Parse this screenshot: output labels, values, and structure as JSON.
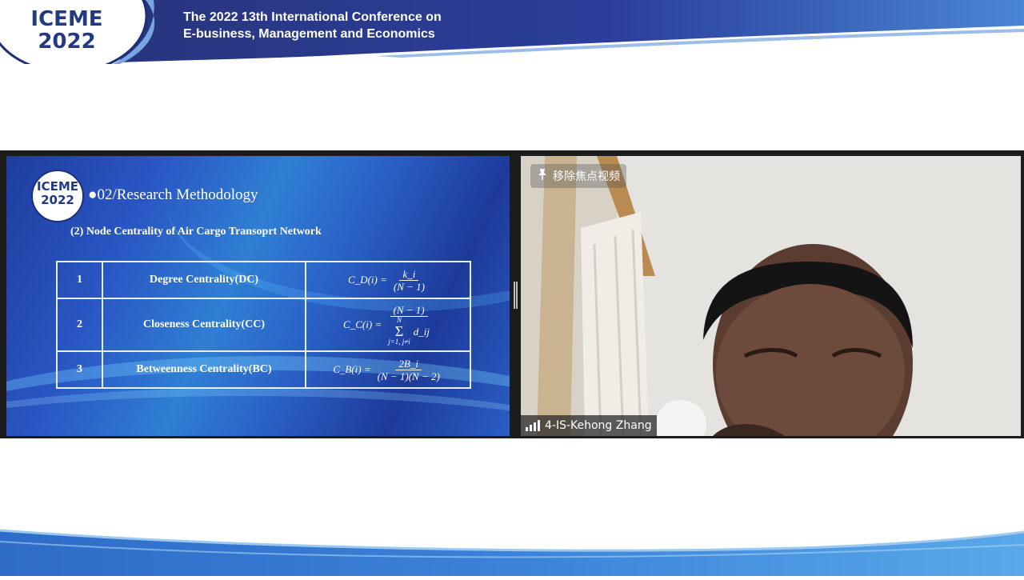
{
  "banner": {
    "logo_line1": "ICEME",
    "logo_line2": "2022",
    "title_line1": "The 2022 13th International Conference on",
    "title_line2": "E-business, Management and Economics"
  },
  "slide": {
    "logo_line1": "ICEME",
    "logo_line2": "2022",
    "heading": "●02/Research Methodology",
    "subheading": "(2) Node Centrality of Air Cargo Transoprt Network",
    "rows": [
      {
        "no": "1",
        "name": "Degree Centrality(DC)"
      },
      {
        "no": "2",
        "name": "Closeness Centrality(CC)"
      },
      {
        "no": "3",
        "name": "Betweenness Centrality(BC)"
      }
    ],
    "formulas": {
      "dc_lhs": "C_D(i) =",
      "dc_num": "k_i",
      "dc_den": "(N − 1)",
      "cc_lhs": "C_C(i) =",
      "cc_num": "(N − 1)",
      "cc_sum_top": "N",
      "cc_sum_sym": "Σ",
      "cc_sum_bottom": "j=1, j≠i",
      "cc_term": "d_ij",
      "bc_lhs": "C_B(i) =",
      "bc_num": "2B_i",
      "bc_den": "(N − 1)(N − 2)"
    }
  },
  "video": {
    "unpin_label": "移除焦点视频",
    "participant_name": "4-IS-Kehong Zhang"
  },
  "icons": [
    "pin-icon",
    "signal-bars-icon",
    "splitter-handle-icon"
  ],
  "colors": {
    "brand_navy": "#233a82",
    "banner_blue": "#2b3f9b",
    "accent_orange": "#e08a3a",
    "slide_blue": "#2a57c4",
    "meeting_bg": "#1c1c1c"
  }
}
